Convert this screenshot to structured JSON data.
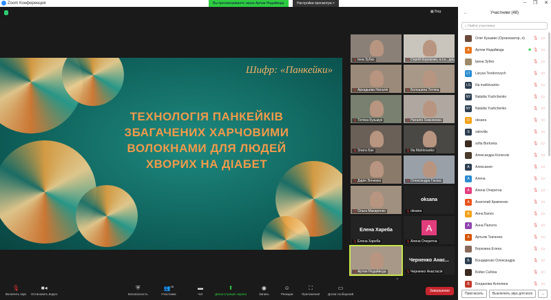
{
  "window": {
    "title": "Zoom Конференция",
    "minimize": "–",
    "restore": "❐",
    "close": "✕"
  },
  "banner": {
    "viewing": "Вы просматриваете экран Артем Недайвода",
    "settings": "Настройки просмотра",
    "settings_close": "×"
  },
  "view_label": "Вид",
  "slide": {
    "cipher": "Шифр: «Панкейки»",
    "title": "ТЕХНОЛОГІЯ ПАНКЕЙКІВ ЗБАГАЧЕНИХ ХАРЧОВИМИ ВОЛОКНАМИ ДЛЯ ЛЮДЕЙ ХВОРИХ НА ДІАБЕТ"
  },
  "tiles": [
    {
      "name": "Інна Зубко",
      "type": "video"
    },
    {
      "name": "Сергій Корнієнко, к.т.н., доц.",
      "type": "video"
    },
    {
      "name": "Аркадьева Наталія",
      "type": "video"
    },
    {
      "name": "Болошина Тетяна",
      "type": "video"
    },
    {
      "name": "Тетяна Кузьмук",
      "type": "video"
    },
    {
      "name": "Наталія Хижнякова",
      "type": "video"
    },
    {
      "name": "Злата Бах",
      "type": "video"
    },
    {
      "name": "Ilia Mahlovanko",
      "type": "video"
    },
    {
      "name": "Дарія Зінченко",
      "type": "video"
    },
    {
      "name": "Олександра Ганзас",
      "type": "video"
    },
    {
      "name": "Ольга Макаренко",
      "type": "video"
    },
    {
      "name": "oksana",
      "type": "name",
      "display": "oksana"
    },
    {
      "name": "Елена Хареба",
      "type": "name",
      "display": "Елена Хареба"
    },
    {
      "name": "Алена Очеретна",
      "type": "avatar",
      "display": "A"
    },
    {
      "name": "Артем Недайвода",
      "type": "video",
      "active": true
    },
    {
      "name": "Черненко Анастасія",
      "type": "name",
      "display": "Черненко Анас..."
    }
  ],
  "toolbar": {
    "unmute": "Включить звук",
    "video": "Остановить видео",
    "security": "Безопасность",
    "participants": "Участники",
    "participants_count": "48",
    "chat": "Чат",
    "share": "Демонстрация экрана",
    "record": "Запись",
    "reactions": "Реакции",
    "apps": "Приложения",
    "whiteboard": "Доски сообщений",
    "end": "Завершение"
  },
  "panel": {
    "title": "Участники (48)",
    "search_placeholder": "Найти участника",
    "participants": [
      {
        "name": "Олег Кузьмин (Организатор, я)",
        "initials": "",
        "color": "#6b4a3a"
      },
      {
        "name": "Артем Недайвода",
        "initials": "A",
        "color": "#e8741c",
        "sharing": true
      },
      {
        "name": "Ірина Зубко",
        "initials": "",
        "color": "#9c8a6a"
      },
      {
        "name": "Larysa Teodorovych",
        "initials": "LT",
        "color": "#2a8bd0"
      },
      {
        "name": "Ilia mahlovanko",
        "initials": "LS",
        "color": "#2c3e50"
      },
      {
        "name": "Nataliia Yushchenko",
        "initials": "NY",
        "color": "#2c3e50"
      },
      {
        "name": "Nataliia Yushchenko",
        "initials": "NY",
        "color": "#2c3e50"
      },
      {
        "name": "oksana",
        "initials": "O",
        "color": "#f2a21c"
      },
      {
        "name": "saloviila",
        "initials": "S",
        "color": "#2c3e50"
      },
      {
        "name": "sofia Bortovkа",
        "initials": "",
        "color": "#3a2a20"
      },
      {
        "name": "Александра Колеснік",
        "initials": "",
        "color": "#4a3a2a"
      },
      {
        "name": "Алексания",
        "initials": "A",
        "color": "#2c3e50"
      },
      {
        "name": "Алена",
        "initials": "A",
        "color": "#2a8bd0"
      },
      {
        "name": "Алена Очеретна",
        "initials": "A",
        "color": "#e23d7c"
      },
      {
        "name": "Анатолий Кравченко",
        "initials": "A",
        "color": "#e8541c"
      },
      {
        "name": "Анна Бапос",
        "initials": "A",
        "color": "#f2a21c"
      },
      {
        "name": "Анна Палюта",
        "initials": "A",
        "color": "#8e44ad"
      },
      {
        "name": "Артьом Ткаченко",
        "initials": "A",
        "color": "#d35400"
      },
      {
        "name": "Березина Елена",
        "initials": "",
        "color": "#8a6a5a"
      },
      {
        "name": "Бондаренко Олександра",
        "initials": "Б",
        "color": "#2c3e50"
      },
      {
        "name": "Бойко Сабіна",
        "initials": "",
        "color": "#3a2a20"
      },
      {
        "name": "Богданова Ангелина",
        "initials": "B",
        "color": "#c0392b"
      }
    ],
    "invite": "Пригласить",
    "unmute_all": "Выключить звук для всех",
    "more": "..."
  }
}
